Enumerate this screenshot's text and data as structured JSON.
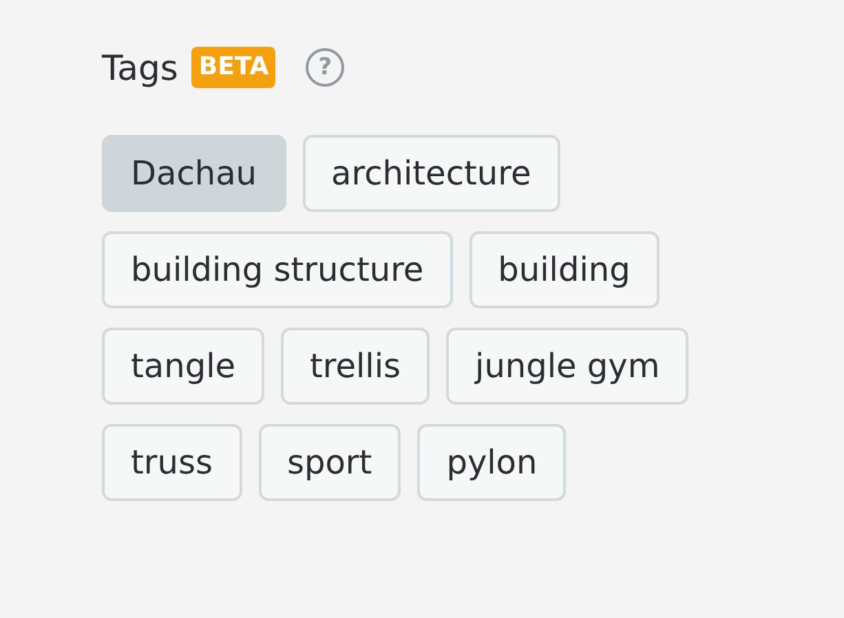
{
  "header": {
    "title": "Tags",
    "badge": "BETA",
    "help": "?"
  },
  "tags": [
    {
      "label": "Dachau",
      "selected": true
    },
    {
      "label": "architecture",
      "selected": false
    },
    {
      "label": "building structure",
      "selected": false
    },
    {
      "label": "building",
      "selected": false
    },
    {
      "label": "tangle",
      "selected": false
    },
    {
      "label": "trellis",
      "selected": false
    },
    {
      "label": "jungle gym",
      "selected": false
    },
    {
      "label": "truss",
      "selected": false
    },
    {
      "label": "sport",
      "selected": false
    },
    {
      "label": "pylon",
      "selected": false
    }
  ]
}
